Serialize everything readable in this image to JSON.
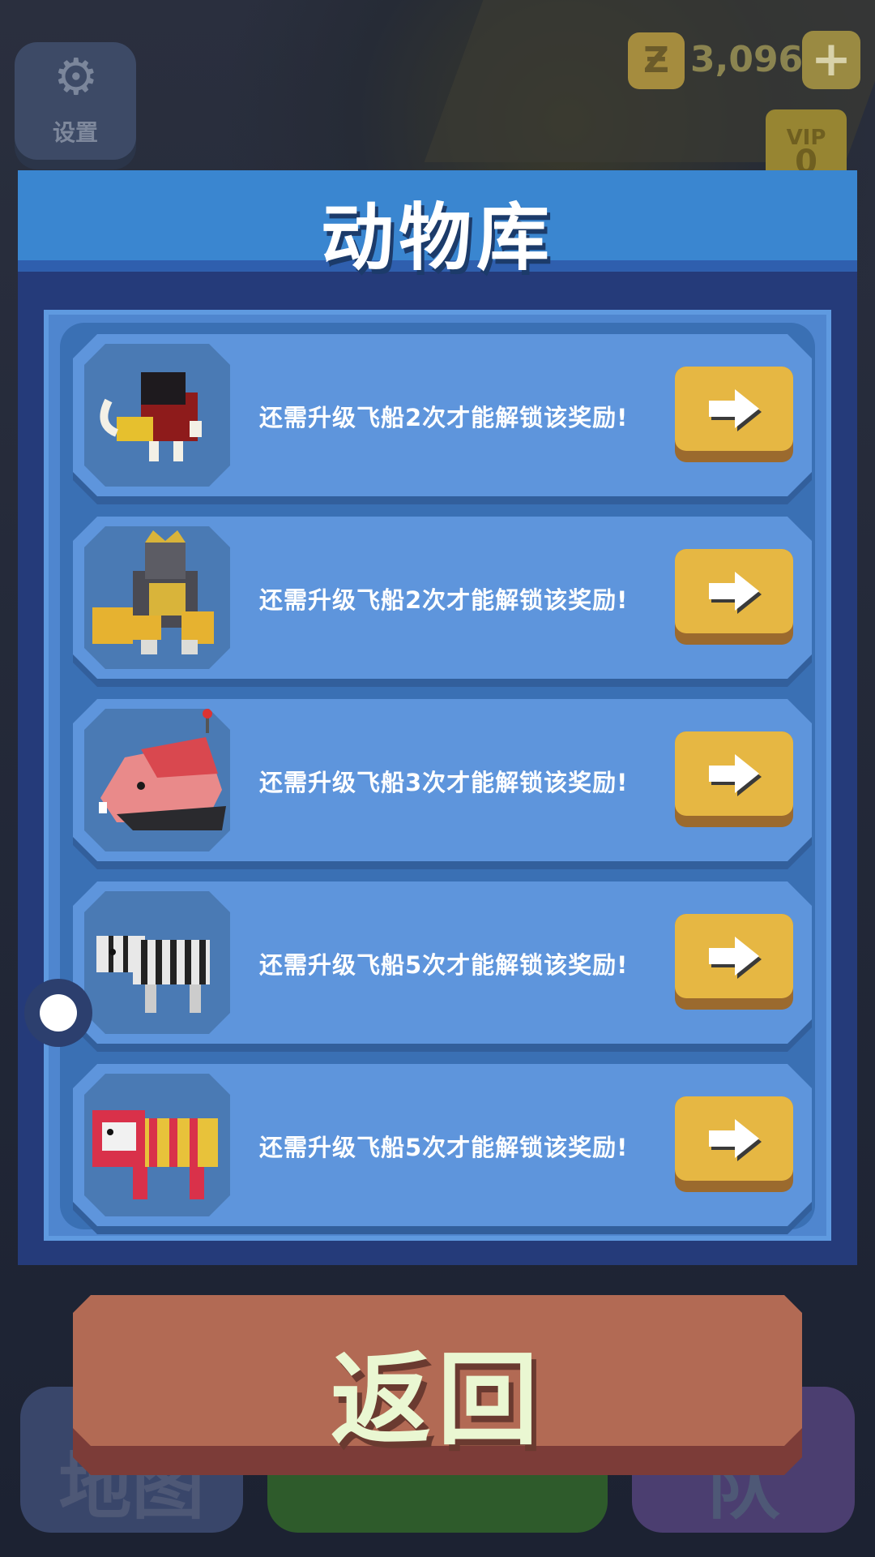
{
  "hud": {
    "settings_label": "设置",
    "currency_symbol": "Ƶ",
    "currency_amount": "3,096",
    "add_label": "+",
    "vip_label": "VIP",
    "vip_level": "0"
  },
  "panel": {
    "title": "动物库"
  },
  "rewards": [
    {
      "animal": "wild boar",
      "text": "还需升级飞船2次才能解锁该奖励!"
    },
    {
      "animal": "gorilla",
      "text": "还需升级飞船2次才能解锁该奖励!"
    },
    {
      "animal": "hippo",
      "text": "还需升级飞船3次才能解锁该奖励!"
    },
    {
      "animal": "zebra",
      "text": "还需升级飞船5次才能解锁该奖励!"
    },
    {
      "animal": "tiger",
      "text": "还需升级飞船5次才能解锁该奖励!"
    }
  ],
  "back_button": {
    "label": "返回"
  },
  "bottom_nav": {
    "left": "地图",
    "right": "队"
  },
  "colors": {
    "panel_header": "#3a86d0",
    "row_bg": "#5e95dc",
    "arrow_button": "#e6b743",
    "back_button": "#b26a54"
  }
}
